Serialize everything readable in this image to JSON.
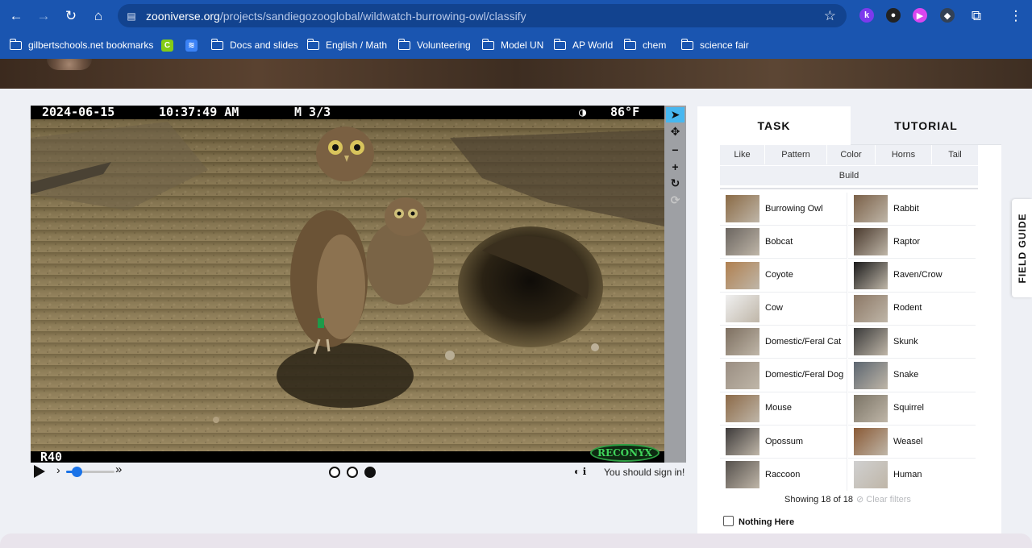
{
  "browser": {
    "url_host": "zooniverse.org",
    "url_path": "/projects/sandiegozooglobal/wildwatch-burrowing-owl/classify",
    "extensions": [
      {
        "icon": "k-extension-icon",
        "letter": "k",
        "color": "#7c3aed"
      },
      {
        "icon": "bear-extension-icon",
        "letter": "",
        "color": "#222222"
      },
      {
        "icon": "video-extension-icon",
        "letter": "",
        "color": "#d946ef"
      },
      {
        "icon": "cube-extension-icon",
        "letter": "",
        "color": "#334155"
      }
    ],
    "bookmarks": [
      {
        "label": "gilbertschools.net bookmarks",
        "type": "managed"
      },
      {
        "label": "",
        "type": "app-c"
      },
      {
        "label": "",
        "type": "app-blue"
      },
      {
        "label": "Docs and slides",
        "type": "folder"
      },
      {
        "label": "English / Math",
        "type": "folder"
      },
      {
        "label": "Volunteering",
        "type": "folder"
      },
      {
        "label": "Model UN",
        "type": "folder"
      },
      {
        "label": "AP World",
        "type": "folder"
      },
      {
        "label": "chem",
        "type": "folder"
      },
      {
        "label": "science fair",
        "type": "folder"
      }
    ]
  },
  "camera": {
    "date": "2024-06-15",
    "time": "10:37:49 AM",
    "frame": "M 3/3",
    "temperature": "86°F",
    "camera_id": "R40",
    "brand": "RECONYX"
  },
  "player": {
    "signin_text": "You should sign in!",
    "frames": 3,
    "current_frame": 3
  },
  "task": {
    "tabs": [
      "TASK",
      "TUTORIAL"
    ],
    "filters": [
      "Like",
      "Pattern",
      "Color",
      "Horns",
      "Tail",
      "Build"
    ],
    "choices": [
      {
        "label": "Burrowing Owl",
        "color": "#8a6a45"
      },
      {
        "label": "Rabbit",
        "color": "#7a6048"
      },
      {
        "label": "Bobcat",
        "color": "#6b6560"
      },
      {
        "label": "Raptor",
        "color": "#4a3a2e"
      },
      {
        "label": "Coyote",
        "color": "#b08050"
      },
      {
        "label": "Raven/Crow",
        "color": "#1c1c1c"
      },
      {
        "label": "Cow",
        "color": "#f0f0f0"
      },
      {
        "label": "Rodent",
        "color": "#8c7866"
      },
      {
        "label": "Domestic/Feral Cat",
        "color": "#7d6f60"
      },
      {
        "label": "Skunk",
        "color": "#3a3a3a"
      },
      {
        "label": "Domestic/Feral Dog",
        "color": "#9a8e82"
      },
      {
        "label": "Snake",
        "color": "#5c6670"
      },
      {
        "label": "Mouse",
        "color": "#8c6a48"
      },
      {
        "label": "Squirrel",
        "color": "#7b7466"
      },
      {
        "label": "Opossum",
        "color": "#3d3a3a"
      },
      {
        "label": "Weasel",
        "color": "#8a5a36"
      },
      {
        "label": "Raccoon",
        "color": "#55504c"
      },
      {
        "label": "Human",
        "color": "#d0d0d0"
      }
    ],
    "showing": "Showing 18 of 18",
    "clear_filters": "Clear filters",
    "nothing_here": "Nothing Here"
  },
  "field_guide": "FIELD GUIDE"
}
